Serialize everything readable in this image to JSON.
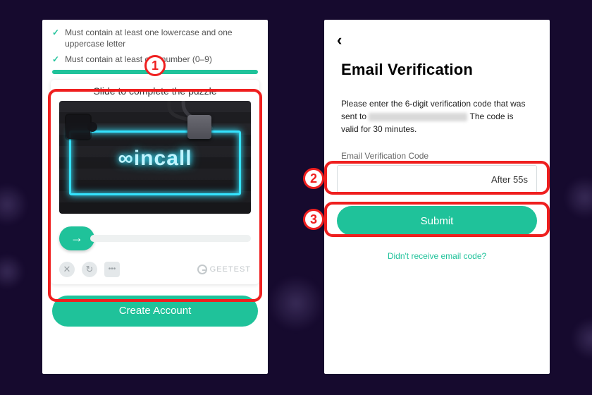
{
  "annotations": {
    "step1": "1",
    "step2": "2",
    "step3": "3"
  },
  "left": {
    "requirements": [
      "Must contain at least one lowercase and one uppercase letter",
      "Must contain at least one number (0–9)"
    ],
    "captcha": {
      "title": "Slide to complete the puzzle",
      "brand_text": "incall",
      "provider": "GEETEST",
      "icons": {
        "close": "close-icon",
        "refresh": "refresh-icon",
        "feedback": "feedback-icon"
      }
    },
    "create_button": "Create Account"
  },
  "right": {
    "title": "Email Verification",
    "description_before": "Please enter the 6-digit verification code that was sent to",
    "description_after": " The code is valid for 30 minutes.",
    "field_label": "Email Verification Code",
    "timer_text": "After 55s",
    "submit": "Submit",
    "resend": "Didn't receive email code?"
  }
}
